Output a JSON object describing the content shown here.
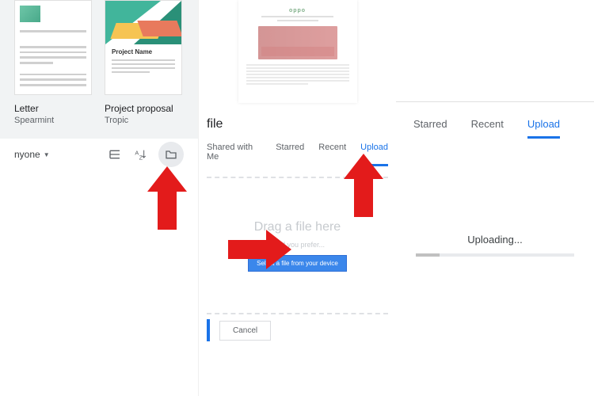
{
  "panel1": {
    "templates": [
      {
        "title": "Letter",
        "subtitle": "Spearmint"
      },
      {
        "title": "Project proposal",
        "subtitle": "Tropic",
        "thumb_label": "Project Name"
      }
    ],
    "owner_filter": "nyone",
    "dropdown_glyph": "▼"
  },
  "panel2": {
    "preview_logo": "oppo",
    "dialog_title_fragment": "file",
    "tabs": [
      "Shared with Me",
      "Starred",
      "Recent",
      "Upload"
    ],
    "active_tab_index": 3,
    "drag_text": "Drag a file here",
    "or_text": "Or, if you prefer...",
    "select_button": "Select a file from your device",
    "cancel_button": "Cancel"
  },
  "panel3": {
    "tabs": [
      "Starred",
      "Recent",
      "Upload"
    ],
    "active_tab_index": 2,
    "status_text": "Uploading..."
  }
}
